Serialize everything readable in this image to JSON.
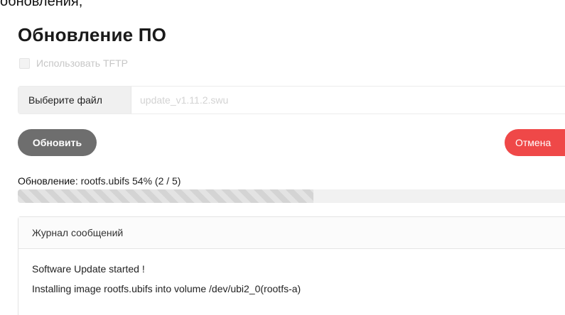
{
  "top_cropped_text": "обновления;",
  "heading": "Обновление ПО",
  "tftp": {
    "label": "Использовать TFTP",
    "checked": false
  },
  "file_input": {
    "button_label": "Выберите файл",
    "file_name": "update_v1.11.2.swu"
  },
  "buttons": {
    "update_label": "Обновить",
    "cancel_label": "Отмена"
  },
  "status": {
    "label": "Обновление:",
    "text": "rootfs.ubifs 54% (2 / 5)",
    "progress_percent": 54
  },
  "log": {
    "title": "Журнал сообщений",
    "lines": [
      "Software Update started !",
      "Installing image rootfs.ubifs into volume /dev/ubi2_0(rootfs-a)"
    ]
  },
  "colors": {
    "update_button": "#6e6e6e",
    "cancel_button": "#ef4848",
    "progress_fill": "#d4d4d4"
  }
}
